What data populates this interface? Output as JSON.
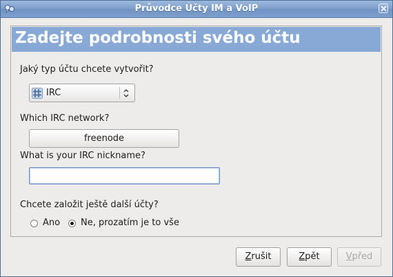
{
  "window": {
    "title": "Průvodce Účty IM a VoIP"
  },
  "header": {
    "title": "Zadejte podrobnosti svého účtu"
  },
  "account_type": {
    "label": "Jaký typ účtu chcete vytvořit?",
    "selected": "IRC",
    "icon": "irc-hash-icon"
  },
  "network": {
    "label": "Which IRC network?",
    "value": "freenode"
  },
  "nickname": {
    "label": "What is your IRC nickname?",
    "value": ""
  },
  "more_accounts": {
    "label": "Chcete založit ještě další účty?",
    "options": [
      {
        "label": "Ano",
        "selected": false
      },
      {
        "label": "Ne, prozatím je to vše",
        "selected": true
      }
    ]
  },
  "buttons": {
    "cancel": {
      "first": "Z",
      "rest": "rušit"
    },
    "back": {
      "first": "Z",
      "rest": "pět"
    },
    "forward": {
      "first": "V",
      "rest": "před"
    }
  },
  "colors": {
    "header_bg": "#88a8d6",
    "titlebar": "#7d9ecb",
    "window_bg": "#edeceb"
  }
}
